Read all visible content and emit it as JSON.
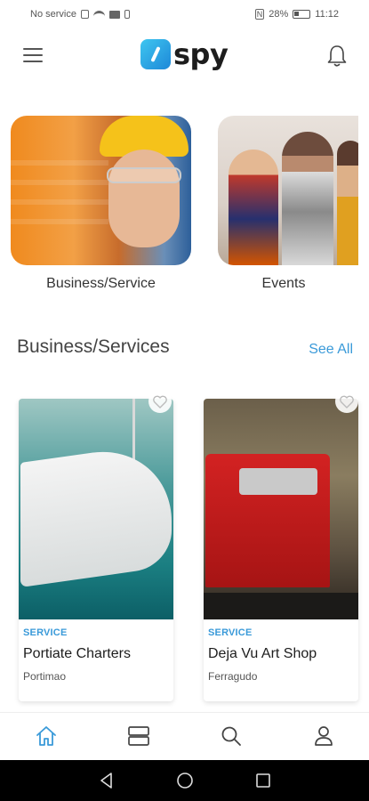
{
  "status_bar": {
    "carrier": "No service",
    "nfc": "N",
    "battery_percent": "28%",
    "time": "11:12"
  },
  "header": {
    "logo_text": "spy",
    "icons": {
      "menu": "hamburger-menu-icon",
      "notifications": "bell-icon"
    }
  },
  "categories": [
    {
      "label": "Business/Service"
    },
    {
      "label": "Events"
    }
  ],
  "section": {
    "title": "Business/Services",
    "see_all": "See All"
  },
  "listings": [
    {
      "tag": "SERVICE",
      "title": "Portiate Charters",
      "location": "Portimao"
    },
    {
      "tag": "SERVICE",
      "title": "Deja Vu Art Shop",
      "location": "Ferragudo"
    }
  ],
  "bottom_nav": [
    "home-icon",
    "list-icon",
    "search-icon",
    "profile-icon"
  ],
  "colors": {
    "accent": "#3a9ad9",
    "logo_gradient_start": "#3ec6f0",
    "logo_gradient_end": "#1e88d8",
    "system_bar": "#000000"
  }
}
